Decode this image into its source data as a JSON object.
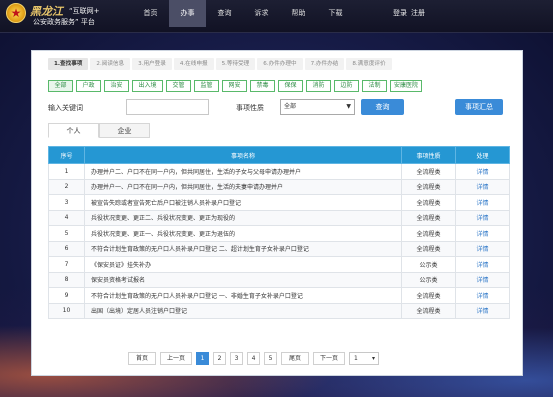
{
  "header": {
    "brand_name": "黑龙江",
    "brand_sub1": "“互联网+",
    "brand_sub2": "公安政务服务” 平台",
    "logo_icon": "police-badge-icon",
    "nav": [
      "首页",
      "办事",
      "查询",
      "诉求",
      "帮助",
      "下载"
    ],
    "nav_active": "办事",
    "login": "登录",
    "register": "注册"
  },
  "steps": [
    "1.查找事项",
    "2.阅读信息",
    "3.用户登录",
    "4.在线申报",
    "5.等待受理",
    "6.办件办理中",
    "7.办件办结",
    "8.满意度评价"
  ],
  "filters": [
    "全部",
    "户政",
    "治安",
    "出入境",
    "交管",
    "监管",
    "网安",
    "禁毒",
    "保保",
    "消防",
    "边防",
    "法制",
    "安康医院"
  ],
  "search": {
    "keyword_label": "输入关键词",
    "keyword_value": "",
    "type_label": "事项性质",
    "type_value": "全部",
    "query_button": "查询",
    "summary_button": "事项汇总"
  },
  "tabs": [
    "个人",
    "企业"
  ],
  "table": {
    "headers": [
      "序号",
      "事项名称",
      "事项性质",
      "处理"
    ],
    "rows": [
      {
        "no": "1",
        "name": "办理并户二、户口不在同一户内，但共同居住，生活的子女与父母申请办理并户",
        "cat": "全流程类",
        "act": "详情"
      },
      {
        "no": "2",
        "name": "办理并户一、户口不在同一户内，但共同居住，生活的夫妻申请办理并户",
        "cat": "全流程类",
        "act": "详情"
      },
      {
        "no": "3",
        "name": "被宣告失踪或者宣告死亡后户口被注销人员补录户口登记",
        "cat": "全流程类",
        "act": "详情"
      },
      {
        "no": "4",
        "name": "兵役状况变更、更正二、兵役状况变更、更正为现役的",
        "cat": "全流程类",
        "act": "详情"
      },
      {
        "no": "5",
        "name": "兵役状况变更、更正一、兵役状况变更、更正为退伍的",
        "cat": "全流程类",
        "act": "详情"
      },
      {
        "no": "6",
        "name": "不符合计划生育政策的无户口人员补录户口登记 二、超计划生育子女补录户口登记",
        "cat": "全流程类",
        "act": "详情"
      },
      {
        "no": "7",
        "name": "《保安员证》挂失补办",
        "cat": "公示类",
        "act": "详情"
      },
      {
        "no": "8",
        "name": "保安员资格考试报名",
        "cat": "公示类",
        "act": "详情"
      },
      {
        "no": "9",
        "name": "不符合计划生育政策的无户口人员补录户口登记 一、非婚生育子女补录户口登记",
        "cat": "全流程类",
        "act": "详情"
      },
      {
        "no": "10",
        "name": "出国（出境）定居人员注销户口登记",
        "cat": "全流程类",
        "act": "详情"
      }
    ]
  },
  "pager": {
    "first": "首页",
    "prev": "上一页",
    "pages": [
      "1",
      "2",
      "3",
      "4",
      "5"
    ],
    "current": "1",
    "last": "尾页",
    "next": "下一页",
    "select_value": "1"
  }
}
